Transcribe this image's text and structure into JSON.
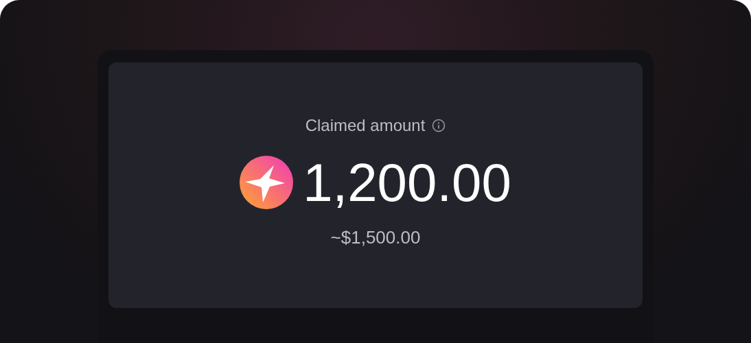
{
  "claim": {
    "label": "Claimed amount",
    "amount": "1,200.00",
    "fiat": "~$1,500.00"
  }
}
